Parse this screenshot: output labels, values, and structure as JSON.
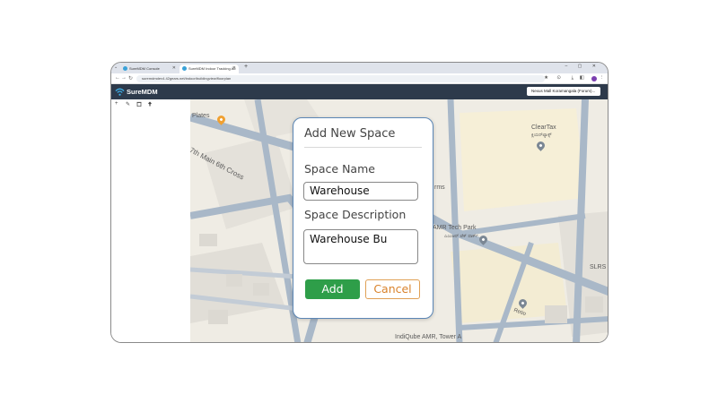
{
  "browser": {
    "tabs": [
      {
        "label": "SureMDM Console"
      },
      {
        "label": "SureMDM Indoor Tracking Ad"
      }
    ],
    "new_tab": "+",
    "window_controls": "–  ▢  ✕",
    "url": "suremdmdev4.42gears.net/indoor/buildingview/floorplan",
    "nav": {
      "back": "←",
      "forward": "→",
      "reload": "↻"
    }
  },
  "app": {
    "brand": "SureMDM",
    "brand_color": "#3fb0e8",
    "header_color": "#2d3a4b",
    "location_select": "Nexus Mall Koramangala (Forum)..."
  },
  "sidebar": {
    "tools": [
      {
        "icon": "plus-icon",
        "glyph": "+"
      },
      {
        "icon": "edit-icon",
        "glyph": "✎"
      },
      {
        "icon": "trash-icon",
        "glyph": "🗑"
      },
      {
        "icon": "pin-icon",
        "glyph": "📌"
      }
    ]
  },
  "map": {
    "labels": {
      "plates": "Plates",
      "street": "7th Main 6th Cross",
      "cleartax": "ClearTax",
      "cleartax_local": "ಕ್ಲಿಯರ್‌ಟ್ಯಾಕ್ಸ್",
      "rms": "rms",
      "techpark": "AMR Tech Park",
      "techpark_local": "ಎಎಂಆರ್ ಟೆಕ್ ಪಾರ್ಕ್",
      "slrs": "SLRS",
      "retio": "Retio",
      "indiqube": "IndiQube AMR, Tower A"
    }
  },
  "dialog": {
    "title": "Add New Space",
    "space_name_label": "Space Name",
    "space_name_value": "Warehouse",
    "space_desc_label": "Space Description",
    "space_desc_value": "Warehouse Bu",
    "add_label": "Add",
    "cancel_label": "Cancel",
    "add_color": "#2e9e49",
    "cancel_color": "#d9822b"
  }
}
